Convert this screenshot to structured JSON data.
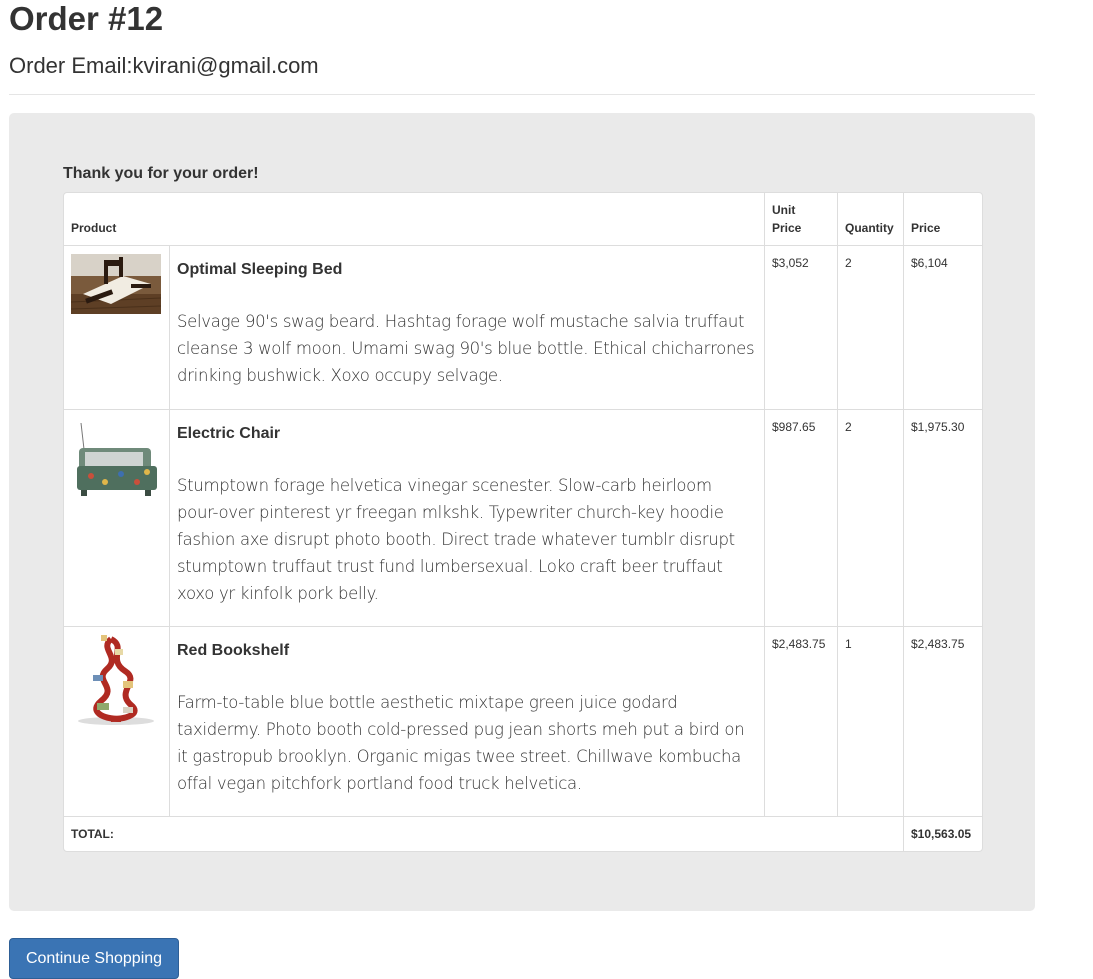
{
  "page": {
    "title": "Order #12",
    "email_label": "Order Email:",
    "email_value": "kvirani@gmail.com"
  },
  "order": {
    "thanks": "Thank you for your order!",
    "columns": {
      "product": "Product",
      "unit_price": "Unit Price",
      "quantity": "Quantity",
      "price": "Price"
    },
    "items": [
      {
        "image_icon": "bed-photo",
        "name": "Optimal Sleeping Bed",
        "description": "Selvage 90's swag beard. Hashtag forage wolf mustache salvia truffaut cleanse 3 wolf moon. Umami swag 90's blue bottle. Ethical chicharrones drinking bushwick. Xoxo occupy selvage.",
        "unit_price": "$3,052",
        "quantity": "2",
        "price": "$6,104"
      },
      {
        "image_icon": "chair-photo",
        "name": "Electric Chair",
        "description": "Stumptown forage helvetica vinegar scenester. Slow-carb heirloom pour-over pinterest yr freegan mlkshk. Typewriter church-key hoodie fashion axe disrupt photo booth. Direct trade whatever tumblr disrupt stumptown truffaut trust fund lumbersexual. Loko craft beer truffaut xoxo yr kinfolk pork belly.",
        "unit_price": "$987.65",
        "quantity": "2",
        "price": "$1,975.30"
      },
      {
        "image_icon": "bookshelf-photo",
        "name": "Red Bookshelf",
        "description": "Farm-to-table blue bottle aesthetic mixtape green juice godard taxidermy. Photo booth cold-pressed pug jean shorts meh put a bird on it gastropub brooklyn. Organic migas twee street. Chillwave kombucha offal vegan pitchfork portland food truck helvetica.",
        "unit_price": "$2,483.75",
        "quantity": "1",
        "price": "$2,483.75"
      }
    ],
    "total_label": "TOTAL:",
    "total_value": "$10,563.05"
  },
  "actions": {
    "continue_label": "Continue Shopping"
  },
  "colors": {
    "button_primary": "#3a74b4",
    "well_background": "#eaeaea"
  }
}
